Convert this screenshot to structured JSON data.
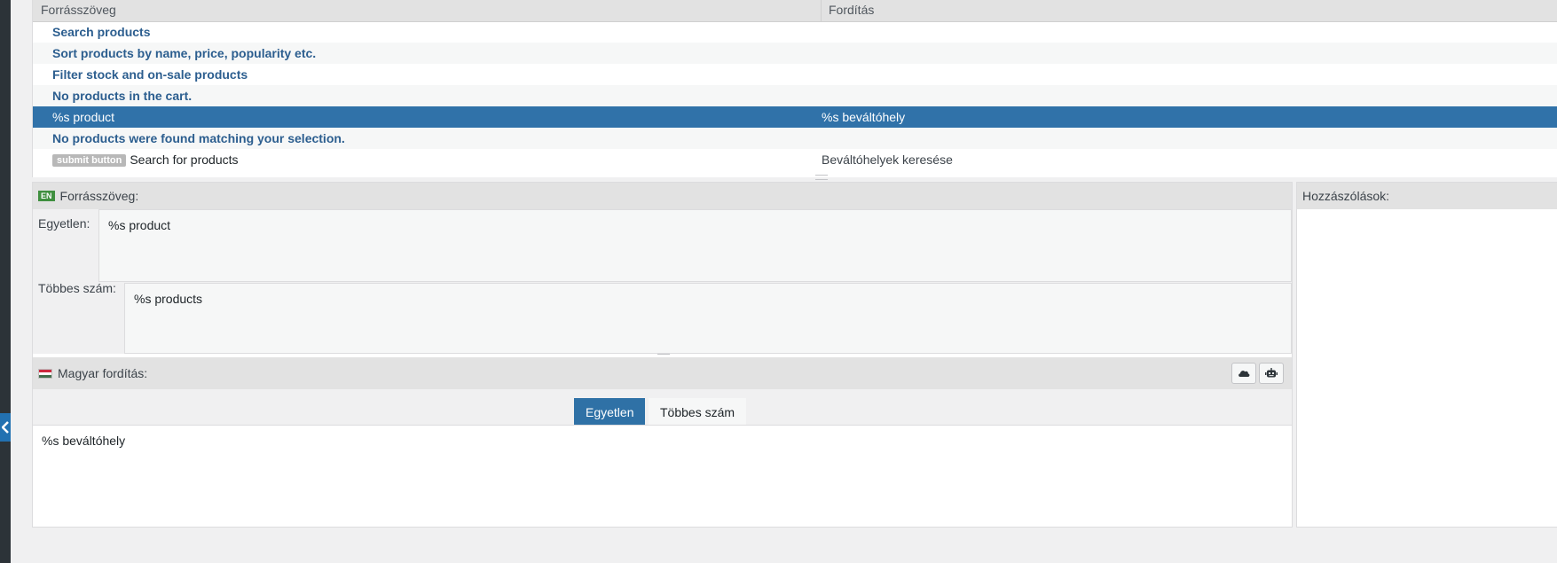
{
  "list": {
    "col_source": "Forrásszöveg",
    "col_translation": "Fordítás",
    "rows": [
      {
        "source": "Search products",
        "translation": ""
      },
      {
        "source": "Sort products by name, price, popularity etc.",
        "translation": ""
      },
      {
        "source": "Filter stock and on-sale products",
        "translation": ""
      },
      {
        "source": "No products in the cart.",
        "translation": ""
      },
      {
        "source": "%s product",
        "translation": "%s beváltóhely"
      },
      {
        "source": "No products were found matching your selection.",
        "translation": ""
      },
      {
        "context": "submit button",
        "source": "Search for products",
        "translation": "Beváltóhelyek keresése"
      }
    ]
  },
  "source_panel": {
    "lang_badge": "EN",
    "title": "Forrásszöveg:",
    "singular_label": "Egyetlen:",
    "singular_value": "%s product",
    "plural_label": "Többes szám:",
    "plural_value": "%s products"
  },
  "translation_panel": {
    "title": "Magyar fordítás:",
    "tabs": [
      "Egyetlen",
      "Többes szám"
    ],
    "active_tab": "Egyetlen",
    "value": "%s beváltóhely",
    "buttons": [
      "cloud-icon",
      "robot-icon"
    ]
  },
  "comments_panel": {
    "title": "Hozzászólások:"
  },
  "colors": {
    "selected_row": "#3072a9",
    "untranslated_text": "#2c5e8f",
    "active_tab": "#2f71a6"
  }
}
